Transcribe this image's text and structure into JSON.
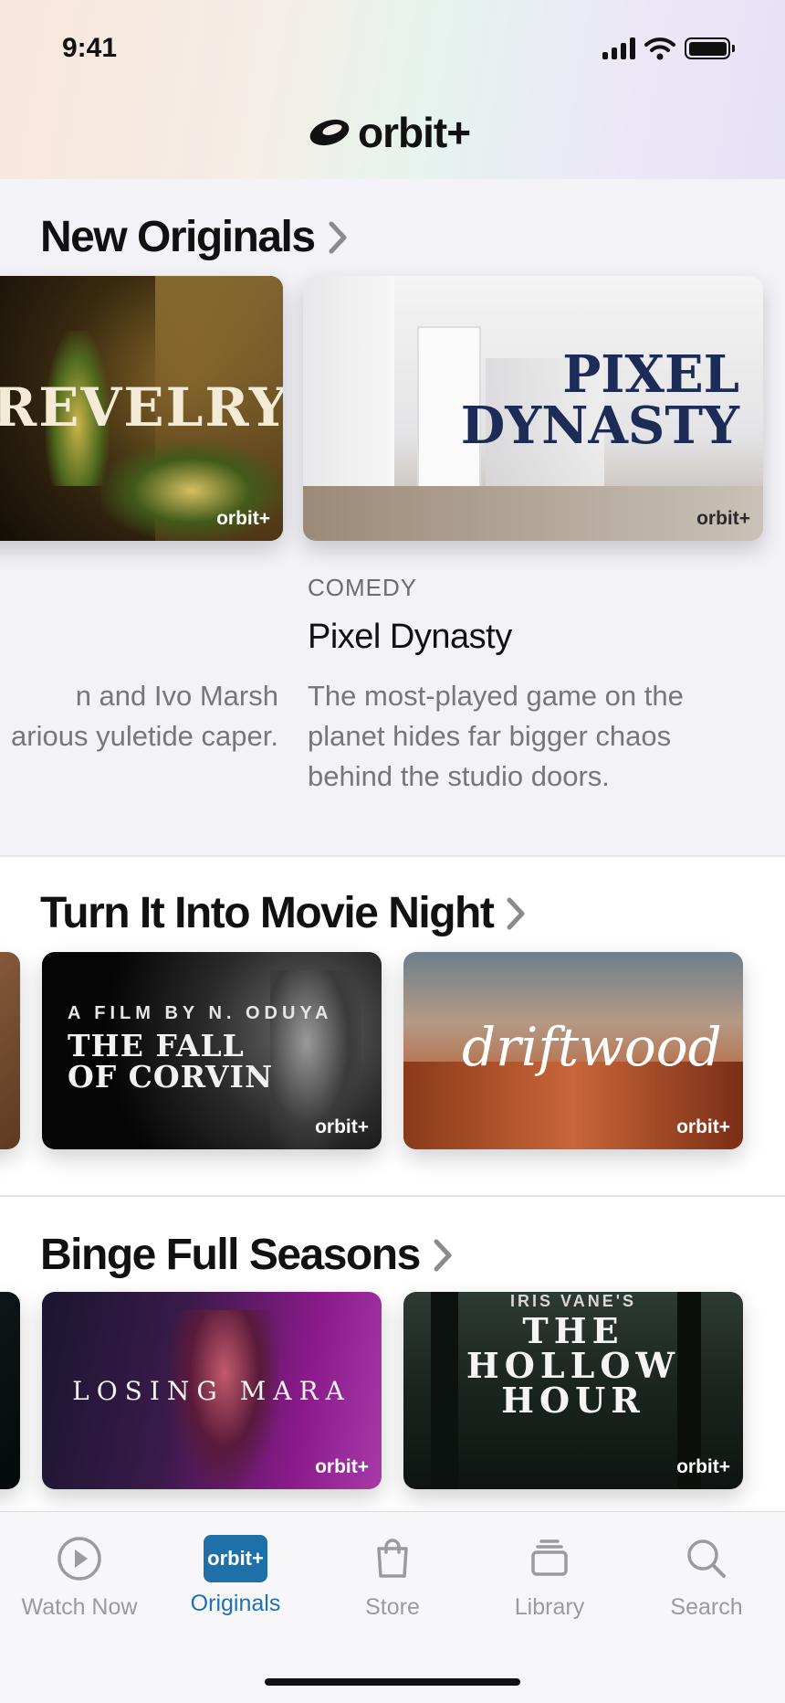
{
  "status": {
    "time": "9:41"
  },
  "app": {
    "logo_text": "orbit+"
  },
  "sections": {
    "new_originals": {
      "title": "New Originals",
      "cards": [
        {
          "title_art": "REVELRY",
          "brand": "orbit+"
        },
        {
          "title_art_line1": "PIXEL",
          "title_art_line2": "DYNASTY",
          "brand": "orbit+"
        }
      ],
      "partial_desc": {
        "line1": "n and Ivo Marsh",
        "line2": "arious yuletide caper."
      },
      "featured": {
        "genre": "COMEDY",
        "title": "Pixel Dynasty",
        "description": "The most-played game on the planet hides far bigger chaos behind the studio doors."
      }
    },
    "movie_night": {
      "title": "Turn It Into Movie Night",
      "cards": [
        {
          "tagline": "A FILM BY N. ODUYA",
          "title_line1": "THE FALL",
          "title_line2": "OF CORVIN",
          "brand": "orbit+"
        },
        {
          "title": "driftwood",
          "brand": "orbit+"
        }
      ]
    },
    "binge": {
      "title": "Binge Full Seasons",
      "cards": [
        {
          "title": "LOSING MARA",
          "brand": "orbit+"
        },
        {
          "tagline": "IRIS VANE'S",
          "title_line1": "THE",
          "title_line2": "HOLLOW",
          "title_line3": "HOUR",
          "brand": "orbit+"
        }
      ]
    }
  },
  "tabs": [
    {
      "label": "Watch Now",
      "icon": "play-circle-icon"
    },
    {
      "label": "Originals",
      "icon": "orbit-badge-icon",
      "badge": "orbit+",
      "active": true
    },
    {
      "label": "Store",
      "icon": "shopping-bag-icon"
    },
    {
      "label": "Library",
      "icon": "stack-icon"
    },
    {
      "label": "Search",
      "icon": "search-icon"
    }
  ],
  "colors": {
    "accent": "#1f6fb5",
    "tab_inactive": "#9a9aa0"
  }
}
